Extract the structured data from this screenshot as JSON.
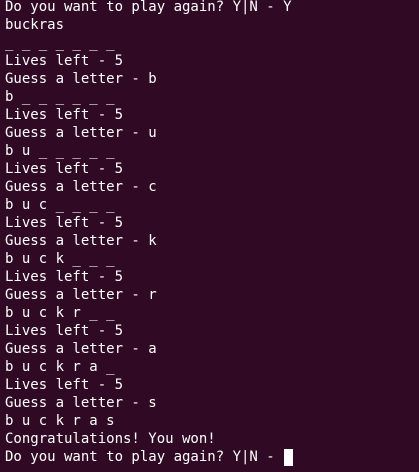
{
  "terminal": {
    "lines": [
      "Do you want to play again? Y|N - Y",
      "buckras",
      "_ _ _ _ _ _ _",
      "Lives left - 5",
      "Guess a letter - b",
      "b _ _ _ _ _ _",
      "Lives left - 5",
      "Guess a letter - u",
      "b u _ _ _ _ _",
      "Lives left - 5",
      "Guess a letter - c",
      "b u c _ _ _ _",
      "Lives left - 5",
      "Guess a letter - k",
      "b u c k _ _ _",
      "Lives left - 5",
      "Guess a letter - r",
      "b u c k r _ _",
      "Lives left - 5",
      "Guess a letter - a",
      "b u c k r a _",
      "Lives left - 5",
      "Guess a letter - s",
      "b u c k r a s",
      "Congratulations! You won!"
    ],
    "prompt": "Do you want to play again? Y|N - ",
    "colors": {
      "background": "#300a24",
      "foreground": "#ffffff",
      "cursor": "#ffffff"
    }
  }
}
